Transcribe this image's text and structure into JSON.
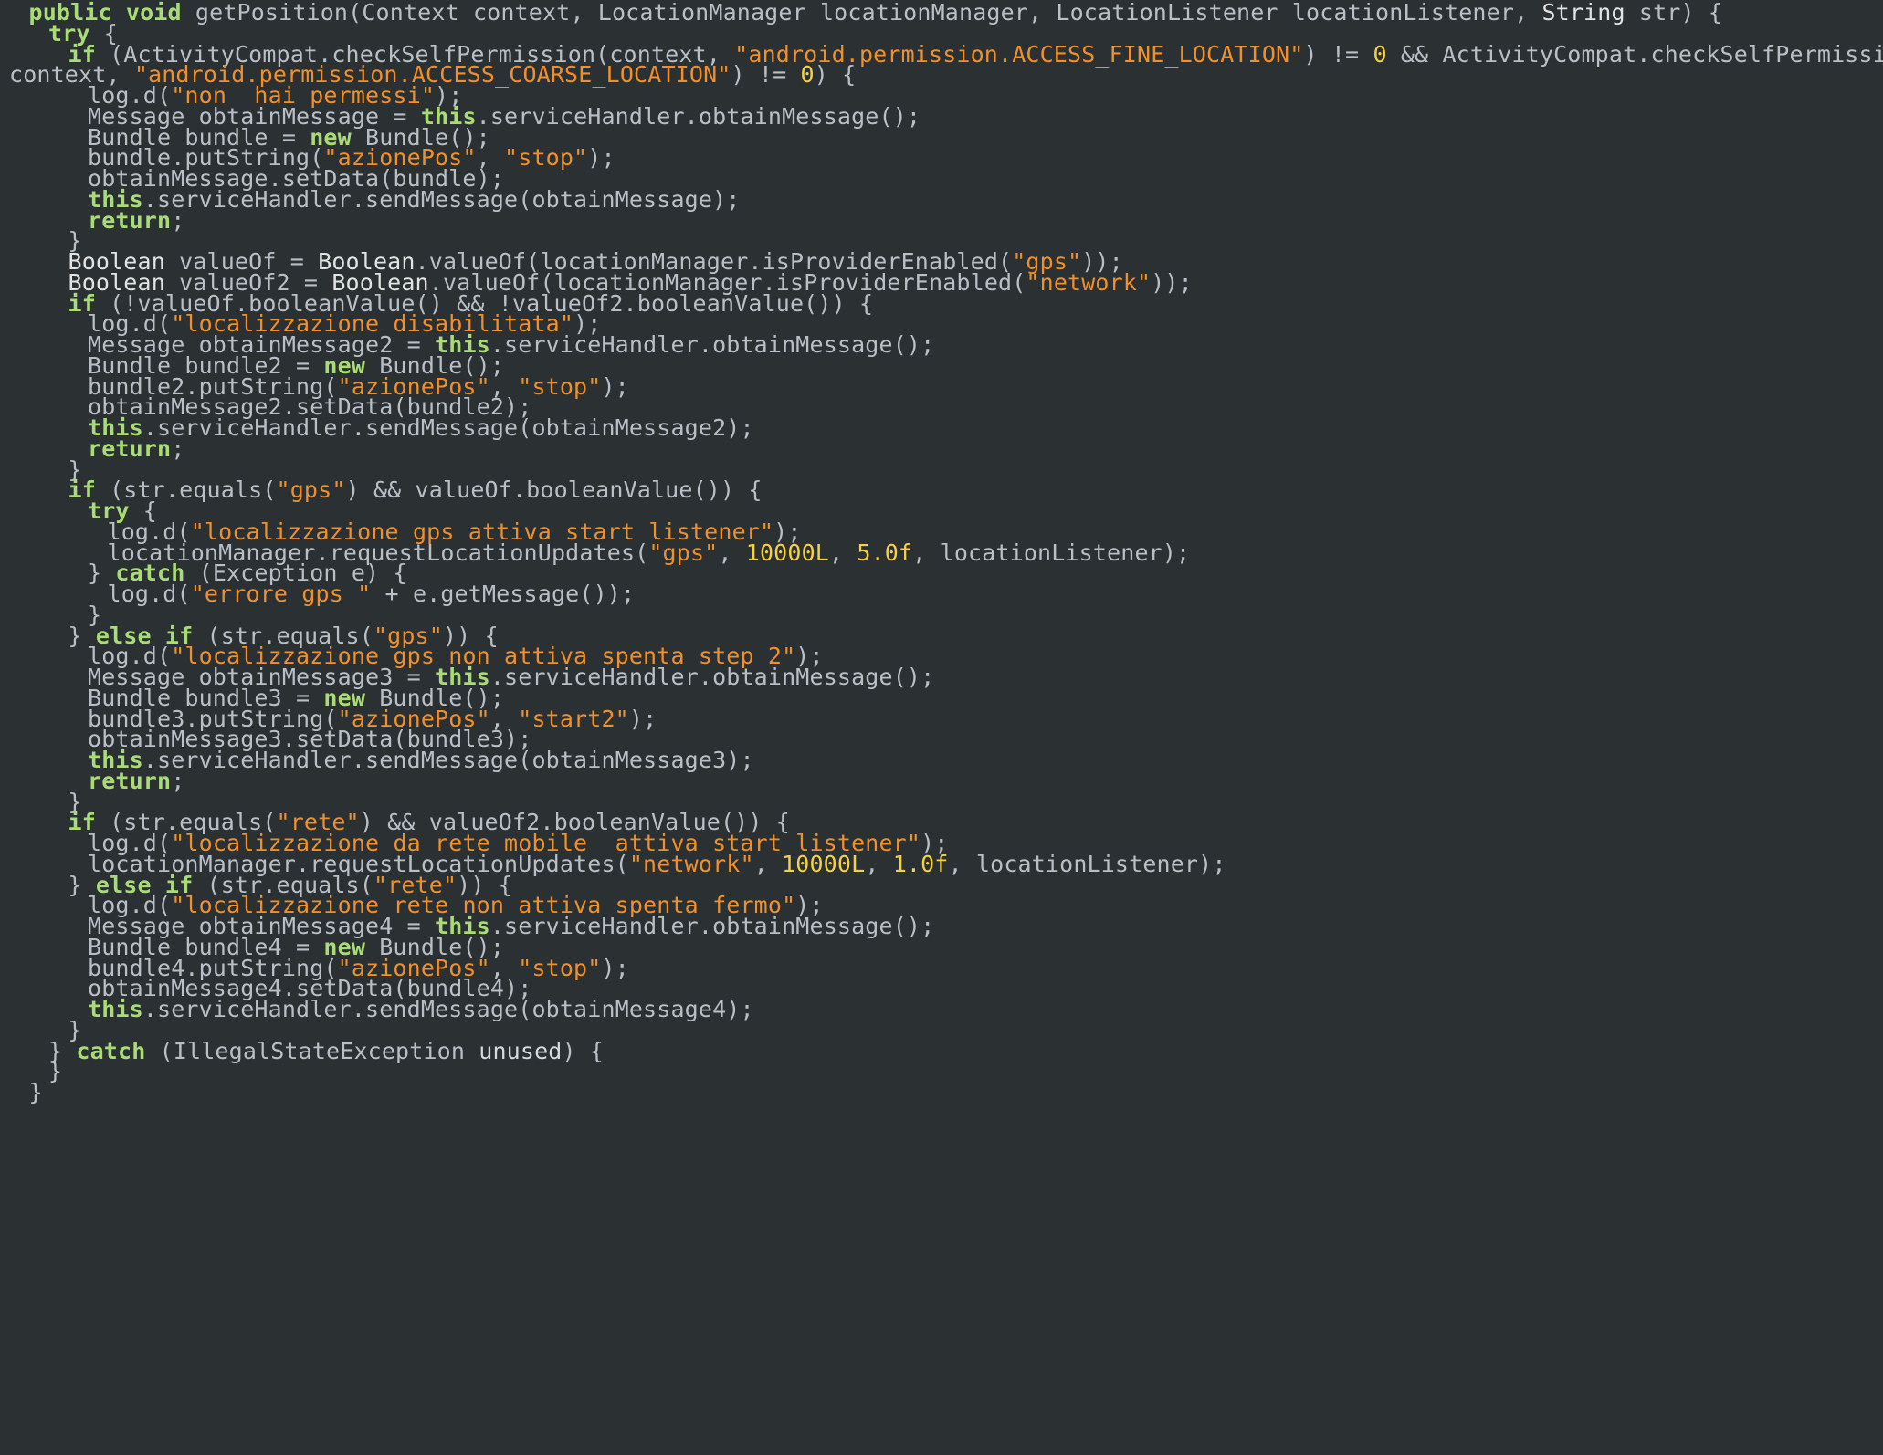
{
  "colors": {
    "background": "#2b3033",
    "keyword": "#a9dc76",
    "string": "#f0902c",
    "number": "#f5d245",
    "identifier": "#d7dae0",
    "plain": "#e2e4e2"
  },
  "code": {
    "lines": [
      {
        "indent": 2,
        "tokens": [
          {
            "t": "public void",
            "c": "kw"
          },
          {
            "t": " getPosition(Context context, LocationManager locationManager, LocationListener locationListener, ",
            "c": "var"
          },
          {
            "t": "String",
            "c": "pl"
          },
          {
            "t": " str) {",
            "c": "var"
          }
        ]
      },
      {
        "indent": 4,
        "tokens": [
          {
            "t": "try",
            "c": "kw"
          },
          {
            "t": " {",
            "c": "var"
          }
        ]
      },
      {
        "indent": 6,
        "tokens": [
          {
            "t": "if",
            "c": "kw"
          },
          {
            "t": " (ActivityCompat.checkSelfPermission(context, ",
            "c": "var"
          },
          {
            "t": "\"android.permission.ACCESS_FINE_LOCATION\"",
            "c": "str"
          },
          {
            "t": ") != ",
            "c": "var"
          },
          {
            "t": "0",
            "c": "num"
          },
          {
            "t": " && ActivityCompat.checkSelfPermission(",
            "c": "var"
          }
        ]
      },
      {
        "indent": 0,
        "tokens": [
          {
            "t": "context, ",
            "c": "var"
          },
          {
            "t": "\"android.permission.ACCESS_COARSE_LOCATION\"",
            "c": "str"
          },
          {
            "t": ") != ",
            "c": "var"
          },
          {
            "t": "0",
            "c": "num"
          },
          {
            "t": ") {",
            "c": "var"
          }
        ]
      },
      {
        "indent": 8,
        "tokens": [
          {
            "t": "log.d(",
            "c": "var"
          },
          {
            "t": "\"non  hai permessi\"",
            "c": "str"
          },
          {
            "t": ");",
            "c": "var"
          }
        ]
      },
      {
        "indent": 8,
        "tokens": [
          {
            "t": "Message obtainMessage = ",
            "c": "var"
          },
          {
            "t": "this",
            "c": "kw"
          },
          {
            "t": ".serviceHandler.obtainMessage();",
            "c": "var"
          }
        ]
      },
      {
        "indent": 8,
        "tokens": [
          {
            "t": "Bundle bundle = ",
            "c": "var"
          },
          {
            "t": "new",
            "c": "kw"
          },
          {
            "t": " Bundle();",
            "c": "var"
          }
        ]
      },
      {
        "indent": 8,
        "tokens": [
          {
            "t": "bundle.putString(",
            "c": "var"
          },
          {
            "t": "\"azionePos\"",
            "c": "str"
          },
          {
            "t": ", ",
            "c": "var"
          },
          {
            "t": "\"stop\"",
            "c": "str"
          },
          {
            "t": ");",
            "c": "var"
          }
        ]
      },
      {
        "indent": 8,
        "tokens": [
          {
            "t": "obtainMessage.setData(bundle);",
            "c": "var"
          }
        ]
      },
      {
        "indent": 8,
        "tokens": [
          {
            "t": "this",
            "c": "kw"
          },
          {
            "t": ".serviceHandler.sendMessage(obtainMessage);",
            "c": "var"
          }
        ]
      },
      {
        "indent": 8,
        "tokens": [
          {
            "t": "return",
            "c": "kw"
          },
          {
            "t": ";",
            "c": "var"
          }
        ]
      },
      {
        "indent": 6,
        "tokens": [
          {
            "t": "}",
            "c": "var"
          }
        ]
      },
      {
        "indent": 6,
        "tokens": [
          {
            "t": "Boolean",
            "c": "pl"
          },
          {
            "t": " valueOf = ",
            "c": "var"
          },
          {
            "t": "Boolean",
            "c": "pl"
          },
          {
            "t": ".valueOf(locationManager.isProviderEnabled(",
            "c": "var"
          },
          {
            "t": "\"gps\"",
            "c": "str"
          },
          {
            "t": "));",
            "c": "var"
          }
        ]
      },
      {
        "indent": 6,
        "tokens": [
          {
            "t": "Boolean",
            "c": "pl"
          },
          {
            "t": " valueOf2 = ",
            "c": "var"
          },
          {
            "t": "Boolean",
            "c": "pl"
          },
          {
            "t": ".valueOf(locationManager.isProviderEnabled(",
            "c": "var"
          },
          {
            "t": "\"network\"",
            "c": "str"
          },
          {
            "t": "));",
            "c": "var"
          }
        ]
      },
      {
        "indent": 6,
        "tokens": [
          {
            "t": "if",
            "c": "kw"
          },
          {
            "t": " (!valueOf.booleanValue() && !valueOf2.booleanValue()) {",
            "c": "var"
          }
        ]
      },
      {
        "indent": 8,
        "tokens": [
          {
            "t": "log.d(",
            "c": "var"
          },
          {
            "t": "\"localizzazione disabilitata\"",
            "c": "str"
          },
          {
            "t": ");",
            "c": "var"
          }
        ]
      },
      {
        "indent": 8,
        "tokens": [
          {
            "t": "Message obtainMessage2 = ",
            "c": "var"
          },
          {
            "t": "this",
            "c": "kw"
          },
          {
            "t": ".serviceHandler.obtainMessage();",
            "c": "var"
          }
        ]
      },
      {
        "indent": 8,
        "tokens": [
          {
            "t": "Bundle bundle2 = ",
            "c": "var"
          },
          {
            "t": "new",
            "c": "kw"
          },
          {
            "t": " Bundle();",
            "c": "var"
          }
        ]
      },
      {
        "indent": 8,
        "tokens": [
          {
            "t": "bundle2.putString(",
            "c": "var"
          },
          {
            "t": "\"azionePos\"",
            "c": "str"
          },
          {
            "t": ", ",
            "c": "var"
          },
          {
            "t": "\"stop\"",
            "c": "str"
          },
          {
            "t": ");",
            "c": "var"
          }
        ]
      },
      {
        "indent": 8,
        "tokens": [
          {
            "t": "obtainMessage2.setData(bundle2);",
            "c": "var"
          }
        ]
      },
      {
        "indent": 8,
        "tokens": [
          {
            "t": "this",
            "c": "kw"
          },
          {
            "t": ".serviceHandler.sendMessage(obtainMessage2);",
            "c": "var"
          }
        ]
      },
      {
        "indent": 8,
        "tokens": [
          {
            "t": "return",
            "c": "kw"
          },
          {
            "t": ";",
            "c": "var"
          }
        ]
      },
      {
        "indent": 6,
        "tokens": [
          {
            "t": "}",
            "c": "var"
          }
        ]
      },
      {
        "indent": 6,
        "tokens": [
          {
            "t": "if",
            "c": "kw"
          },
          {
            "t": " (str.equals(",
            "c": "var"
          },
          {
            "t": "\"gps\"",
            "c": "str"
          },
          {
            "t": ") && valueOf.booleanValue()) {",
            "c": "var"
          }
        ]
      },
      {
        "indent": 8,
        "tokens": [
          {
            "t": "try",
            "c": "kw"
          },
          {
            "t": " {",
            "c": "var"
          }
        ]
      },
      {
        "indent": 10,
        "tokens": [
          {
            "t": "log.d(",
            "c": "var"
          },
          {
            "t": "\"localizzazione gps attiva start listener\"",
            "c": "str"
          },
          {
            "t": ");",
            "c": "var"
          }
        ]
      },
      {
        "indent": 10,
        "tokens": [
          {
            "t": "locationManager.requestLocationUpdates(",
            "c": "var"
          },
          {
            "t": "\"gps\"",
            "c": "str"
          },
          {
            "t": ", ",
            "c": "var"
          },
          {
            "t": "10000L",
            "c": "num"
          },
          {
            "t": ", ",
            "c": "var"
          },
          {
            "t": "5.0f",
            "c": "num"
          },
          {
            "t": ", locationListener);",
            "c": "var"
          }
        ]
      },
      {
        "indent": 8,
        "tokens": [
          {
            "t": "} ",
            "c": "var"
          },
          {
            "t": "catch",
            "c": "kw"
          },
          {
            "t": " (Exception e) {",
            "c": "var"
          }
        ]
      },
      {
        "indent": 10,
        "tokens": [
          {
            "t": "log.d(",
            "c": "var"
          },
          {
            "t": "\"errore gps \"",
            "c": "str"
          },
          {
            "t": " + e.getMessage());",
            "c": "var"
          }
        ]
      },
      {
        "indent": 8,
        "tokens": [
          {
            "t": "}",
            "c": "var"
          }
        ]
      },
      {
        "indent": 6,
        "tokens": [
          {
            "t": "} ",
            "c": "var"
          },
          {
            "t": "else if",
            "c": "kw"
          },
          {
            "t": " (str.equals(",
            "c": "var"
          },
          {
            "t": "\"gps\"",
            "c": "str"
          },
          {
            "t": ")) {",
            "c": "var"
          }
        ]
      },
      {
        "indent": 8,
        "tokens": [
          {
            "t": "log.d(",
            "c": "var"
          },
          {
            "t": "\"localizzazione gps non attiva spenta step 2\"",
            "c": "str"
          },
          {
            "t": ");",
            "c": "var"
          }
        ]
      },
      {
        "indent": 8,
        "tokens": [
          {
            "t": "Message obtainMessage3 = ",
            "c": "var"
          },
          {
            "t": "this",
            "c": "kw"
          },
          {
            "t": ".serviceHandler.obtainMessage();",
            "c": "var"
          }
        ]
      },
      {
        "indent": 8,
        "tokens": [
          {
            "t": "Bundle bundle3 = ",
            "c": "var"
          },
          {
            "t": "new",
            "c": "kw"
          },
          {
            "t": " Bundle();",
            "c": "var"
          }
        ]
      },
      {
        "indent": 8,
        "tokens": [
          {
            "t": "bundle3.putString(",
            "c": "var"
          },
          {
            "t": "\"azionePos\"",
            "c": "str"
          },
          {
            "t": ", ",
            "c": "var"
          },
          {
            "t": "\"start2\"",
            "c": "str"
          },
          {
            "t": ");",
            "c": "var"
          }
        ]
      },
      {
        "indent": 8,
        "tokens": [
          {
            "t": "obtainMessage3.setData(bundle3);",
            "c": "var"
          }
        ]
      },
      {
        "indent": 8,
        "tokens": [
          {
            "t": "this",
            "c": "kw"
          },
          {
            "t": ".serviceHandler.sendMessage(obtainMessage3);",
            "c": "var"
          }
        ]
      },
      {
        "indent": 8,
        "tokens": [
          {
            "t": "return",
            "c": "kw"
          },
          {
            "t": ";",
            "c": "var"
          }
        ]
      },
      {
        "indent": 6,
        "tokens": [
          {
            "t": "}",
            "c": "var"
          }
        ]
      },
      {
        "indent": 6,
        "tokens": [
          {
            "t": "if",
            "c": "kw"
          },
          {
            "t": " (str.equals(",
            "c": "var"
          },
          {
            "t": "\"rete\"",
            "c": "str"
          },
          {
            "t": ") && valueOf2.booleanValue()) {",
            "c": "var"
          }
        ]
      },
      {
        "indent": 8,
        "tokens": [
          {
            "t": "log.d(",
            "c": "var"
          },
          {
            "t": "\"localizzazione da rete mobile  attiva start listener\"",
            "c": "str"
          },
          {
            "t": ");",
            "c": "var"
          }
        ]
      },
      {
        "indent": 8,
        "tokens": [
          {
            "t": "locationManager.requestLocationUpdates(",
            "c": "var"
          },
          {
            "t": "\"network\"",
            "c": "str"
          },
          {
            "t": ", ",
            "c": "var"
          },
          {
            "t": "10000L",
            "c": "num"
          },
          {
            "t": ", ",
            "c": "var"
          },
          {
            "t": "1.0f",
            "c": "num"
          },
          {
            "t": ", locationListener);",
            "c": "var"
          }
        ]
      },
      {
        "indent": 6,
        "tokens": [
          {
            "t": "} ",
            "c": "var"
          },
          {
            "t": "else if",
            "c": "kw"
          },
          {
            "t": " (str.equals(",
            "c": "var"
          },
          {
            "t": "\"rete\"",
            "c": "str"
          },
          {
            "t": ")) {",
            "c": "var"
          }
        ]
      },
      {
        "indent": 8,
        "tokens": [
          {
            "t": "log.d(",
            "c": "var"
          },
          {
            "t": "\"localizzazione rete non attiva spenta fermo\"",
            "c": "str"
          },
          {
            "t": ");",
            "c": "var"
          }
        ]
      },
      {
        "indent": 8,
        "tokens": [
          {
            "t": "Message obtainMessage4 = ",
            "c": "var"
          },
          {
            "t": "this",
            "c": "kw"
          },
          {
            "t": ".serviceHandler.obtainMessage();",
            "c": "var"
          }
        ]
      },
      {
        "indent": 8,
        "tokens": [
          {
            "t": "Bundle bundle4 = ",
            "c": "var"
          },
          {
            "t": "new",
            "c": "kw"
          },
          {
            "t": " Bundle();",
            "c": "var"
          }
        ]
      },
      {
        "indent": 8,
        "tokens": [
          {
            "t": "bundle4.putString(",
            "c": "var"
          },
          {
            "t": "\"azionePos\"",
            "c": "str"
          },
          {
            "t": ", ",
            "c": "var"
          },
          {
            "t": "\"stop\"",
            "c": "str"
          },
          {
            "t": ");",
            "c": "var"
          }
        ]
      },
      {
        "indent": 8,
        "tokens": [
          {
            "t": "obtainMessage4.setData(bundle4);",
            "c": "var"
          }
        ]
      },
      {
        "indent": 8,
        "tokens": [
          {
            "t": "this",
            "c": "kw"
          },
          {
            "t": ".serviceHandler.sendMessage(obtainMessage4);",
            "c": "var"
          }
        ]
      },
      {
        "indent": 6,
        "tokens": [
          {
            "t": "}",
            "c": "var"
          }
        ]
      },
      {
        "indent": 4,
        "tokens": [
          {
            "t": "} ",
            "c": "var"
          },
          {
            "t": "catch",
            "c": "kw"
          },
          {
            "t": " (IllegalStateException ",
            "c": "var"
          },
          {
            "t": "unused",
            "c": "id"
          },
          {
            "t": ") {",
            "c": "var"
          }
        ]
      },
      {
        "indent": 4,
        "tokens": [
          {
            "t": "}",
            "c": "var"
          }
        ]
      },
      {
        "indent": 2,
        "tokens": [
          {
            "t": "}",
            "c": "var"
          }
        ]
      }
    ]
  }
}
